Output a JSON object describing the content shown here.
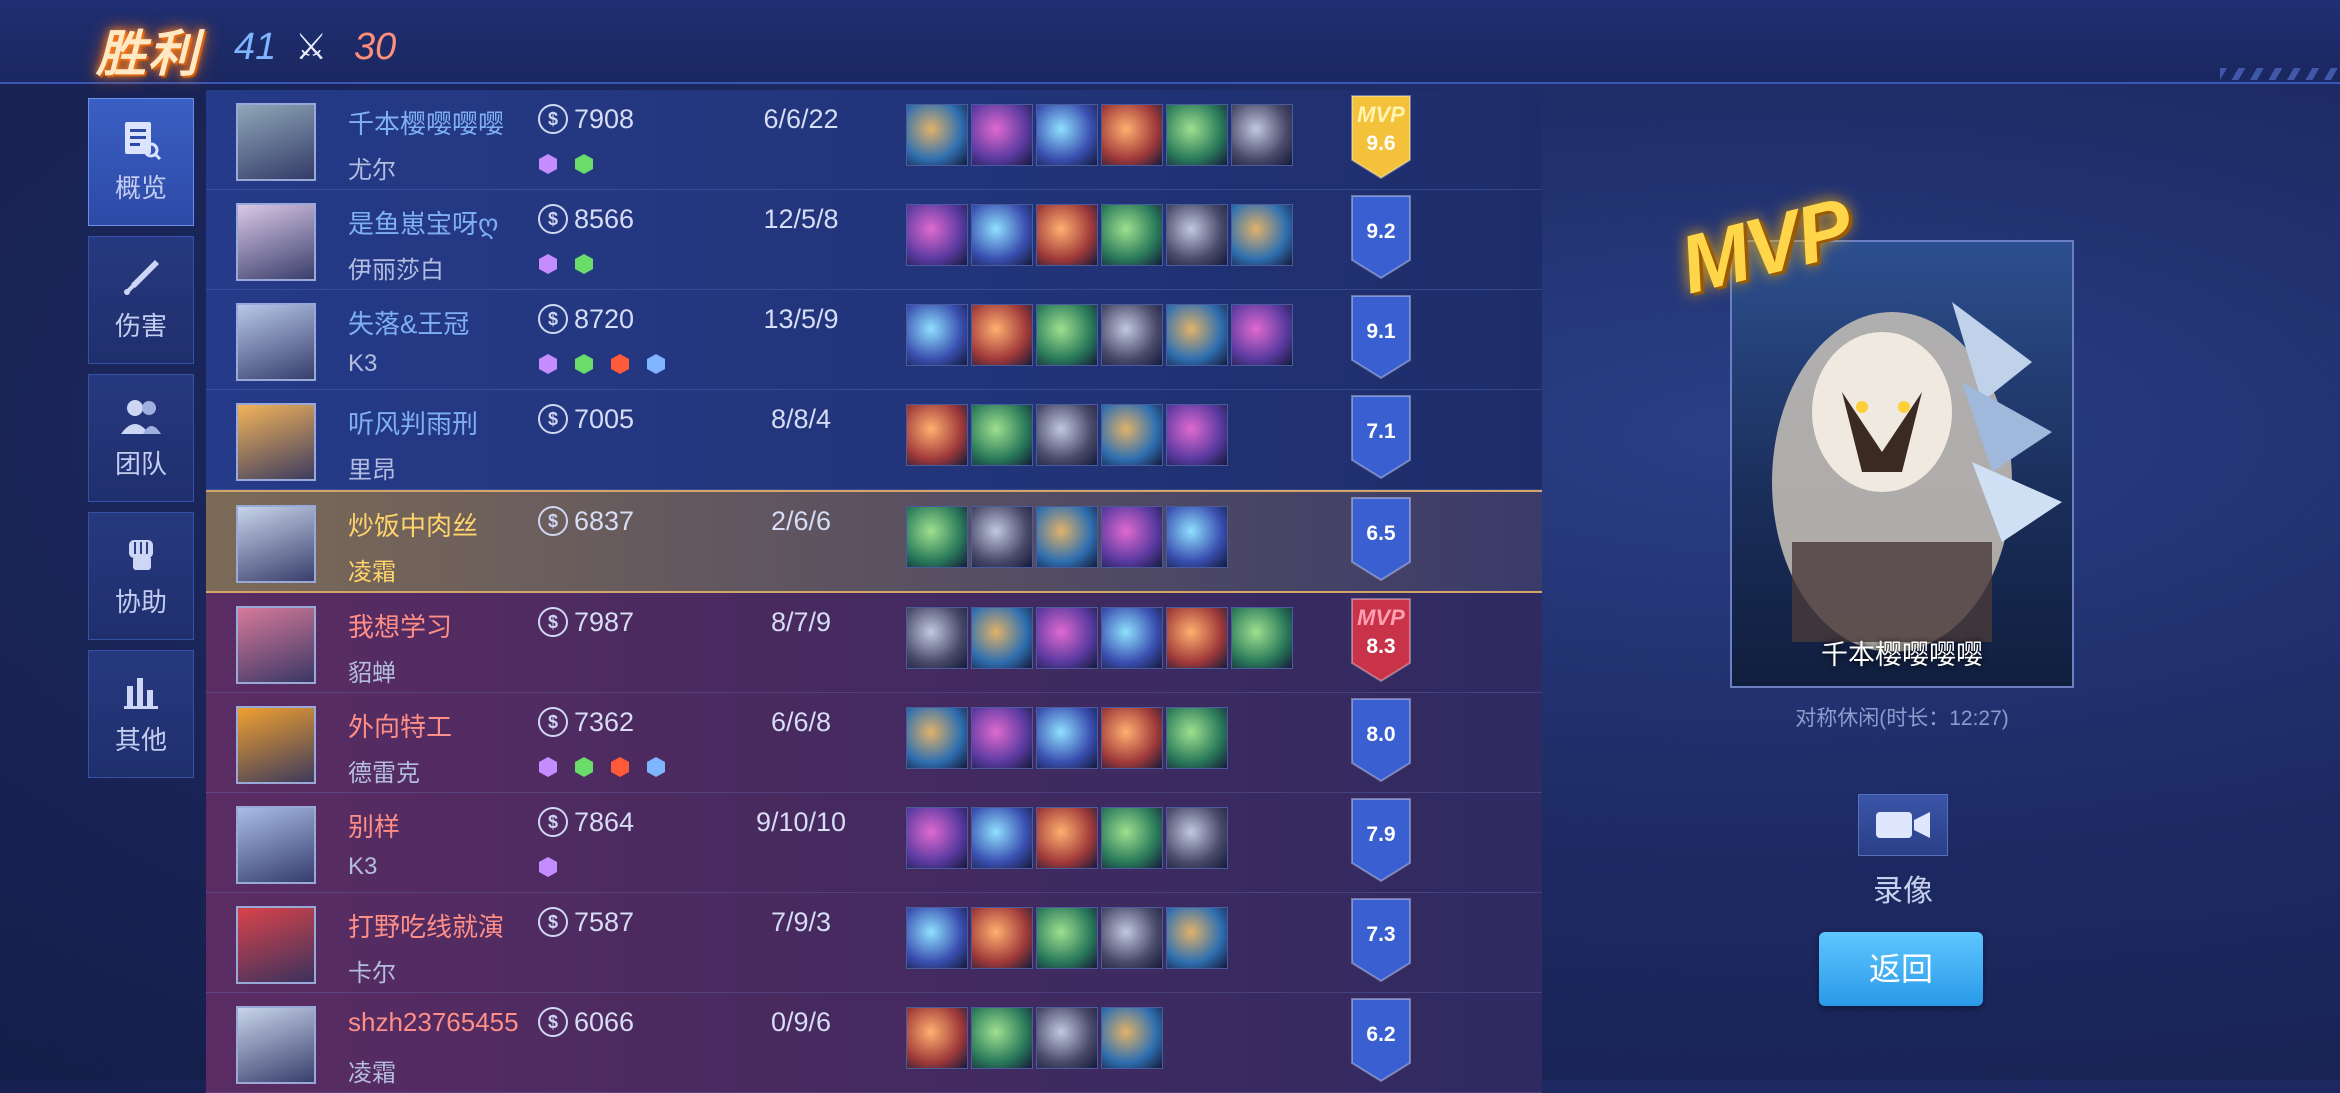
{
  "header": {
    "result": "胜利",
    "blue_kills": "41",
    "red_kills": "30"
  },
  "nav": [
    {
      "label": "概览",
      "icon": "overview-icon",
      "active": true
    },
    {
      "label": "伤害",
      "icon": "sword-icon"
    },
    {
      "label": "团队",
      "icon": "team-icon"
    },
    {
      "label": "协助",
      "icon": "fist-icon"
    },
    {
      "label": "其他",
      "icon": "bar-chart-icon"
    }
  ],
  "players": [
    {
      "team": "blue",
      "player": "千本樱嘤嘤嘤",
      "hero": "尤尔",
      "gold": "7908",
      "kda": "6/6/22",
      "items": 6,
      "score": "9.6",
      "mvp": "MVP",
      "badges": [
        "tower-badge-icon",
        "fist-badge-icon"
      ],
      "avatar_color": "#8fa7b8"
    },
    {
      "team": "blue",
      "player": "是鱼崽宝呀ღ",
      "hero": "伊丽莎白",
      "gold": "8566",
      "kda": "12/5/8",
      "items": 6,
      "score": "9.2",
      "mvp": "",
      "badges": [
        "fire-badge-icon",
        "hood-badge-icon"
      ],
      "avatar_color": "#d9c8e6"
    },
    {
      "team": "blue",
      "player": "失落&王冠",
      "hero": "K3",
      "gold": "8720",
      "kda": "13/5/9",
      "items": 6,
      "score": "9.1",
      "mvp": "",
      "badges": [
        "triple-kill-icon",
        "dagger-badge-icon",
        "tower-badge-icon",
        "coin-badge-icon"
      ],
      "avatar_color": "#b7c7e8"
    },
    {
      "team": "blue",
      "player": "听风判雨刑",
      "hero": "里昂",
      "gold": "7005",
      "kda": "8/8/4",
      "items": 5,
      "score": "7.1",
      "mvp": "",
      "badges": [],
      "avatar_color": "#f2b35a"
    },
    {
      "team": "me",
      "player": "炒饭中肉丝",
      "hero": "凌霜",
      "gold": "6837",
      "kda": "2/6/6",
      "items": 5,
      "score": "6.5",
      "mvp": "",
      "badges": [],
      "avatar_color": "#c8d4ea"
    },
    {
      "team": "red",
      "player": "我想学习",
      "hero": "貂蝉",
      "gold": "7987",
      "kda": "8/7/9",
      "items": 6,
      "score": "8.3",
      "mvp": "MVP",
      "badges": [],
      "avatar_color": "#d67a9a"
    },
    {
      "team": "red",
      "player": "外向特工",
      "hero": "德雷克",
      "gold": "7362",
      "kda": "6/6/8",
      "items": 5,
      "score": "8.0",
      "mvp": "",
      "badges": [
        "shield-badge-icon",
        "eye-badge-icon",
        "slash-badge-icon",
        "potion-badge-icon"
      ],
      "avatar_color": "#f0a030"
    },
    {
      "team": "red",
      "player": "别样",
      "hero": "K3",
      "gold": "7864",
      "kda": "9/10/10",
      "items": 5,
      "score": "7.9",
      "mvp": "",
      "badges": [
        "tower-badge-icon"
      ],
      "avatar_color": "#a9bde6"
    },
    {
      "team": "red",
      "player": "打野吃线就演",
      "hero": "卡尔",
      "gold": "7587",
      "kda": "7/9/3",
      "items": 5,
      "score": "7.3",
      "mvp": "",
      "badges": [],
      "avatar_color": "#d9434a"
    },
    {
      "team": "red",
      "player": "shzh23765455",
      "hero": "凌霜",
      "gold": "6066",
      "kda": "0/9/6",
      "items": 4,
      "score": "6.2",
      "mvp": "",
      "badges": [],
      "avatar_color": "#c8d4ea"
    }
  ],
  "mvp_card": {
    "logo": "MVP",
    "name": "千本樱嘤嘤嘤",
    "mode": "对称休闲(时长：12:27)"
  },
  "record": {
    "label": "录像",
    "icon": "video-camera-icon"
  },
  "back": {
    "label": "返回"
  },
  "colors": {
    "blue_score": "#3a5fd0",
    "mvp_gold": "#f4c13a",
    "mvp_red": "#c8334a",
    "accent": "#2a9ae8"
  }
}
